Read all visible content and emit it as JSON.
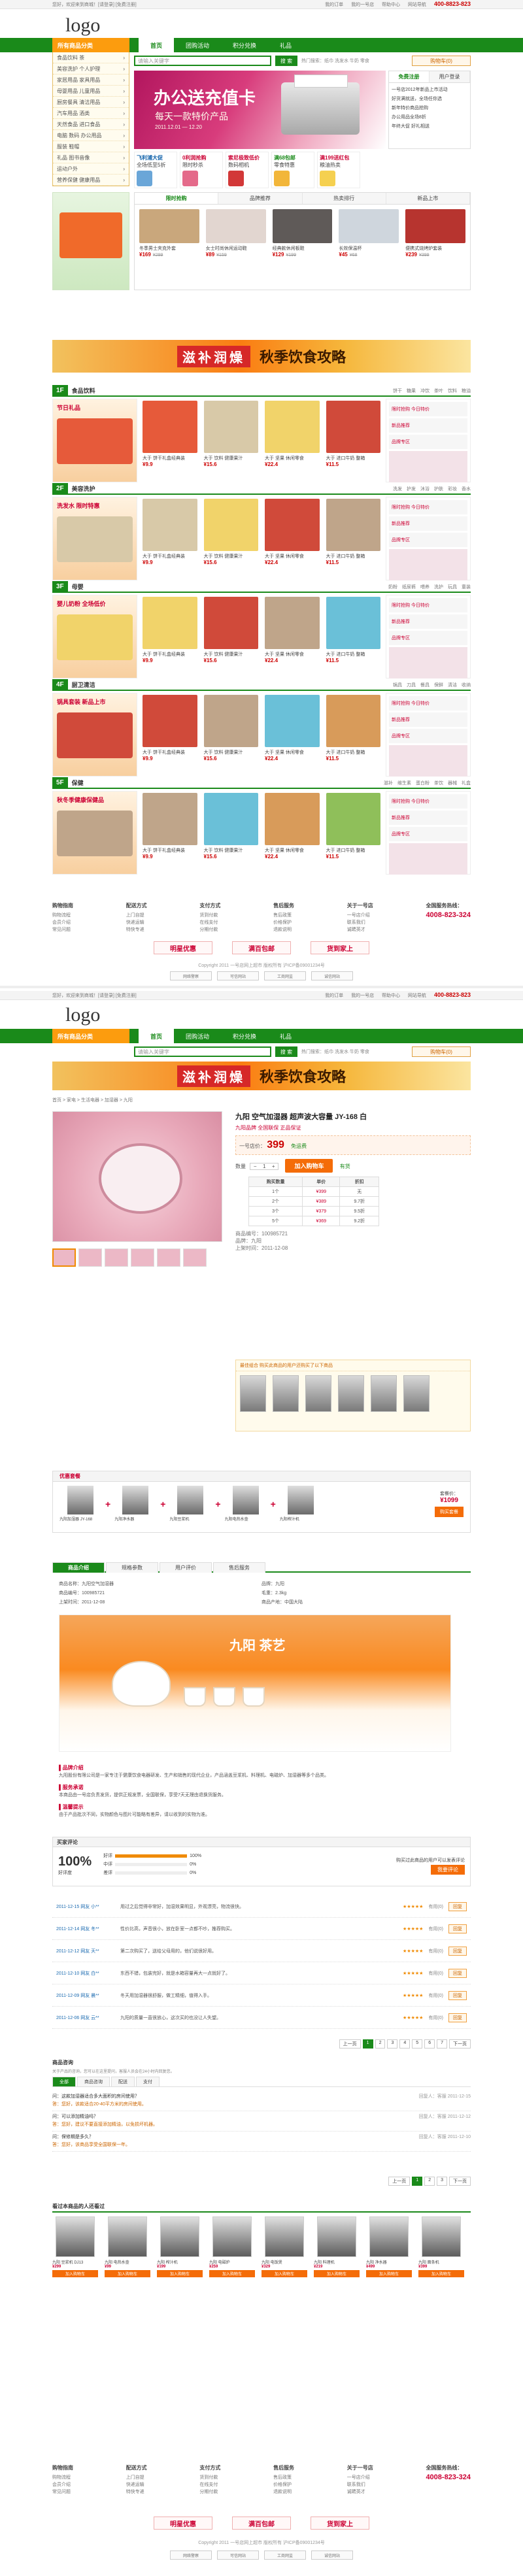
{
  "header": {
    "top_left": "您好，欢迎来到商城！[请登录] [免费注册]",
    "links": [
      "我的订单",
      "我的一号店",
      "帮助中心",
      "网站导航"
    ],
    "hotline": "400-8823-823",
    "logo": "logo"
  },
  "nav": {
    "category_label": "所有商品分类",
    "tabs": [
      "首页",
      "团购活动",
      "积分兑换",
      "礼品"
    ],
    "search_placeholder": "请输入关键字",
    "search_button": "搜 索",
    "hotwords": "热门搜索：纸巾 洗发水 牛奶 零食",
    "cart_label": "购物车(0)"
  },
  "sidebar": {
    "items": [
      "食品饮料 茶",
      "美容洗护 个人护理",
      "家居用品 家具用品",
      "母婴用品 儿童用品",
      "厨房餐具 清洁用品",
      "汽车用品 酒类",
      "天然食品 进口食品",
      "电脑 数码 办公用品",
      "服装 鞋帽",
      "礼品 图书音像",
      "运动户外",
      "营养保健 健康用品"
    ]
  },
  "banner": {
    "title": "办公送充值卡",
    "subtitle": "每天一款特价产品",
    "date": "2011.12.01 — 12.20"
  },
  "promos": [
    {
      "title": "飞利浦大促",
      "desc": "全场低至5折"
    },
    {
      "title": "0利润抢购",
      "desc": "限时秒杀"
    },
    {
      "title": "索尼极致低价",
      "desc": "数码相机"
    },
    {
      "title": "满68包邮",
      "desc": "零食特惠"
    },
    {
      "title": "满199送红包",
      "desc": "粮油热卖"
    }
  ],
  "right_box": {
    "tabs": [
      "免费注册",
      "用户登录"
    ],
    "news": [
      "一号店2012年新品上市活动",
      "好货满就送，全场任你选",
      "新年特价商品抢购",
      "办公用品全场8折",
      "年终大促 好礼相送"
    ]
  },
  "hot_tabs": [
    "限时抢购",
    "品牌推荐",
    "热卖排行",
    "新品上市"
  ],
  "hot_products": [
    {
      "name": "冬季男士夹克外套",
      "price": "¥169",
      "old": "¥299"
    },
    {
      "name": "女士时尚休闲运动鞋",
      "price": "¥89",
      "old": "¥159"
    },
    {
      "name": "经典款休闲板鞋",
      "price": "¥129",
      "old": "¥199"
    },
    {
      "name": "长效保温杯",
      "price": "¥45",
      "old": "¥68"
    },
    {
      "name": "便携式烧烤炉套装",
      "price": "¥239",
      "old": "¥399"
    }
  ],
  "wide_banner": {
    "left": "滋补润燥",
    "right": "秋季饮食攻略"
  },
  "floors": [
    {
      "num": "1F",
      "name": "食品饮料",
      "ad": "节日礼品",
      "subs": [
        "饼干",
        "糖果",
        "冲饮",
        "茶叶",
        "饮料",
        "粮油"
      ]
    },
    {
      "num": "2F",
      "name": "美容洗护",
      "ad": "洗发水 限时特惠",
      "subs": [
        "洗发",
        "护发",
        "沐浴",
        "护肤",
        "彩妆",
        "香水"
      ]
    },
    {
      "num": "3F",
      "name": "母婴",
      "ad": "婴儿奶粉 全场低价",
      "subs": [
        "奶粉",
        "纸尿裤",
        "喂养",
        "洗护",
        "玩具",
        "童装"
      ]
    },
    {
      "num": "4F",
      "name": "厨卫清洁",
      "ad": "锅具套装 新品上市",
      "subs": [
        "锅具",
        "刀具",
        "餐具",
        "保鲜",
        "清洁",
        "收纳"
      ]
    },
    {
      "num": "5F",
      "name": "保健",
      "ad": "秋冬季健康保健品",
      "subs": [
        "滋补",
        "维生素",
        "蛋白粉",
        "茶饮",
        "器械",
        "礼盒"
      ]
    }
  ],
  "floor_products": [
    {
      "name": "大于 饼干礼盒经典装",
      "price": "¥9.9"
    },
    {
      "name": "大于 饮料 健康果汁",
      "price": "¥15.6"
    },
    {
      "name": "大于 坚果 休闲零食",
      "price": "¥22.4"
    },
    {
      "name": "大于 进口牛奶 整箱",
      "price": "¥11.5"
    }
  ],
  "floor_right": [
    "限时抢购 今日特价",
    "新品推荐",
    "品牌专区"
  ],
  "footer": {
    "cols": [
      {
        "h": "购物指南",
        "items": [
          "购物流程",
          "会员介绍",
          "常见问题"
        ]
      },
      {
        "h": "配送方式",
        "items": [
          "上门自提",
          "快递运输",
          "特快专递"
        ]
      },
      {
        "h": "支付方式",
        "items": [
          "货到付款",
          "在线支付",
          "分期付款"
        ]
      },
      {
        "h": "售后服务",
        "items": [
          "售后政策",
          "价格保护",
          "退款说明"
        ]
      },
      {
        "h": "关于一号店",
        "items": [
          "一号店介绍",
          "联系我们",
          "诚聘英才"
        ]
      }
    ],
    "hotline_label": "全国服务热线：",
    "hotline": "4008-823-324",
    "badges": [
      "明星优惠",
      "满百包邮",
      "货到家上"
    ],
    "copyright": "Copyright 2011 一号店网上超市 版权所有 沪ICP备09001234号",
    "certs": [
      "网络警察",
      "可信网站",
      "工商网监",
      "诚信网站"
    ]
  },
  "product": {
    "breadcrumb": "首页 > 家电 > 生活电器 > 加湿器 > 九阳",
    "title": "九阳 空气加湿器 超声波大容量 JY-168 白",
    "subtitle": "九阳品牌 全国联保 正品保证",
    "price_label": "一号店价：",
    "price": "399",
    "price_note": "免运费",
    "qty_label": "数量",
    "qty": "1",
    "buy": "加入购物车",
    "stock": "有货",
    "table_head": [
      "购买数量",
      "单价",
      "折扣"
    ],
    "table_rows": [
      [
        "1个",
        "¥399",
        "无"
      ],
      [
        "2个",
        "¥389",
        "9.7折"
      ],
      [
        "3个",
        "¥379",
        "9.5折"
      ],
      [
        "5个",
        "¥369",
        "9.2折"
      ]
    ],
    "meta": [
      "商品编号：100985721",
      "品牌：九阳",
      "上架时间：2011-12-08"
    ],
    "combo_head": "最佳组合 购买此商品的用户还购买了以下商品"
  },
  "package": {
    "title": "优惠套餐",
    "items": [
      "九阳加湿器 JY-168",
      "九阳净水器",
      "九阳豆浆机",
      "九阳电热水壶",
      "九阳榨汁机"
    ],
    "price_label": "套餐价：",
    "price": "¥1099",
    "buy": "购买套餐"
  },
  "detail_tabs": [
    "商品介绍",
    "规格参数",
    "用户评价",
    "售后服务"
  ],
  "attrs": [
    "商品名称：九阳空气加湿器",
    "品牌：九阳",
    "商品编号：100985721",
    "毛重：2.3kg",
    "上架时间：2011-12-08",
    "商品产地：中国大陆"
  ],
  "detail_banner": {
    "title": "九阳 茶艺"
  },
  "desc": [
    {
      "h": "▌品牌介绍",
      "t": "九阳股份有限公司是一家专注于健康饮食电器研发、生产和销售的现代企业，产品涵盖豆浆机、料理机、电磁炉、加湿器等多个品类。"
    },
    {
      "h": "▌服务承诺",
      "t": "本商品由一号店负责发货，提供正规发票，全国联保，享受7天无理由退换货服务。"
    },
    {
      "h": "▌温馨提示",
      "t": "由于产品批次不同，实物颜色与图片可能略有差异，请以收到的实物为准。"
    }
  ],
  "review": {
    "title": "买家评论",
    "percent": "100%",
    "percent_label": "好评度",
    "levels": [
      {
        "l": "好评",
        "p": 100,
        "v": "100%"
      },
      {
        "l": "中评",
        "p": 0,
        "v": "0%"
      },
      {
        "l": "差评",
        "p": 0,
        "v": "0%"
      }
    ],
    "hint": "购买过此商品的用户可以发表评论",
    "btn": "我要评论",
    "items": [
      {
        "u": "2011-12-15 网友 小**",
        "c": "用过之后觉得非常好，加湿效果明显，外观漂亮，物流很快。"
      },
      {
        "u": "2011-12-14 网友 冬**",
        "c": "性价比高，声音很小，放在卧室一点都不吵，推荐购买。"
      },
      {
        "u": "2011-12-12 网友 天**",
        "c": "第二次购买了，送给父母用的，他们说很好用。"
      },
      {
        "u": "2011-12-10 网友 白**",
        "c": "东西不错，包装完好，就是水箱容量再大一点就好了。"
      },
      {
        "u": "2011-12-09 网友 晨**",
        "c": "冬天用加湿器很舒服，做工精细，值得入手。"
      },
      {
        "u": "2011-12-06 网友 云**",
        "c": "九阳的质量一直很放心，这次买的也没让人失望。"
      }
    ],
    "stars": "★★★★★",
    "useful": "有用(0)",
    "reply": "回复"
  },
  "pager": [
    "上一页",
    "1",
    "2",
    "3",
    "4",
    "5",
    "6",
    "7",
    "下一页"
  ],
  "qa": {
    "title": "商品咨询",
    "sub": "关于产品的咨询，您可以在这里提问，客服人员会在24小时内回复您。",
    "tabs": [
      "全部",
      "商品咨询",
      "配送",
      "支付"
    ],
    "items": [
      {
        "q": "问：这款加湿器适合多大面积的房间使用？",
        "a": "答：您好，该款适合20-40平方米的房间使用。",
        "r": "回复人：客服 2011-12-15"
      },
      {
        "q": "问：可以添加精油吗？",
        "a": "答：您好，建议不要直接添加精油，以免损坏机器。",
        "r": "回复人：客服 2011-12-12"
      },
      {
        "q": "问：保修期是多久？",
        "a": "答：您好，该商品享受全国联保一年。",
        "r": "回复人：客服 2011-12-10"
      }
    ]
  },
  "also": {
    "title": "看过本商品的人还看过",
    "items": [
      {
        "n": "九阳 豆浆机 DJ13",
        "p": "¥299"
      },
      {
        "n": "九阳 电热水壶",
        "p": "¥99"
      },
      {
        "n": "九阳 榨汁机",
        "p": "¥199"
      },
      {
        "n": "九阳 电磁炉",
        "p": "¥259"
      },
      {
        "n": "九阳 电饭煲",
        "p": "¥329"
      },
      {
        "n": "九阳 料理机",
        "p": "¥219"
      },
      {
        "n": "九阳 净水器",
        "p": "¥499"
      },
      {
        "n": "九阳 面条机",
        "p": "¥399"
      }
    ],
    "buy": "加入购物车"
  }
}
